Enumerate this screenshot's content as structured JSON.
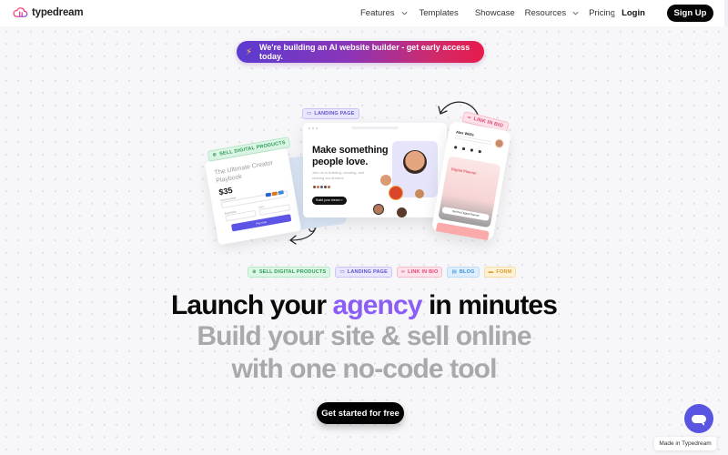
{
  "brand": {
    "name": "typedream",
    "logo_icon": "cloud-gradient-icon"
  },
  "nav": {
    "links": [
      {
        "label": "Features",
        "has_dropdown": true
      },
      {
        "label": "Templates",
        "has_dropdown": false
      },
      {
        "label": "Showcase",
        "has_dropdown": false
      },
      {
        "label": "Resources",
        "has_dropdown": true
      },
      {
        "label": "Pricing",
        "has_dropdown": false
      }
    ],
    "login_label": "Login",
    "signup_label": "Sign Up"
  },
  "banner": {
    "icon": "lightning-bolt-icon",
    "text": "We're building an AI website builder - get early access today."
  },
  "mockups": {
    "sell_card": {
      "tag": "SELL DIGITAL PRODUCTS",
      "title": "The Ultimate Creator Playbook",
      "price": "$35",
      "card_number_label": "Card number",
      "card_number_placeholder": "1234 1234 1234 1234",
      "expiration_label": "Expiration",
      "expiration_placeholder": "MM/YY",
      "cvc_label": "CVC",
      "cvc_placeholder": "CVC",
      "pay_label": "Pay now"
    },
    "landing_card": {
      "tag": "LANDING PAGE",
      "headline": "Make something people love.",
      "subtext": "Join us in building, creating, and sharing our dreams",
      "button": "Build your dream >"
    },
    "link_card": {
      "tag": "LINK IN BIO",
      "name": "Alex Willis",
      "product_title": "Digital Planner",
      "cta": "Get the Digital Planner"
    }
  },
  "feature_chips": [
    {
      "label": "SELL DIGITAL PRODUCTS",
      "icon": "dollar-circle-icon",
      "color": "#2f9a58"
    },
    {
      "label": "LANDING PAGE",
      "icon": "window-icon",
      "color": "#5d55c8"
    },
    {
      "label": "LINK IN BIO",
      "icon": "link-icon",
      "color": "#e0467a"
    },
    {
      "label": "BLOG",
      "icon": "document-icon",
      "color": "#3a8ed8"
    },
    {
      "label": "FORM",
      "icon": "form-icon",
      "color": "#d89a2a"
    }
  ],
  "hero": {
    "line1_prefix": "Launch your ",
    "line1_accent": "agency",
    "line1_suffix": " in minutes",
    "line2": "Build your site & sell online",
    "line3": "with one no-code tool",
    "accent_color": "#8b5cf6"
  },
  "cta": {
    "label": "Get started for free"
  },
  "footer_badge": {
    "label": "Made in Typedream"
  },
  "chat_widget": {
    "icon": "chat-bubble-icon",
    "color": "#5a55e0"
  }
}
